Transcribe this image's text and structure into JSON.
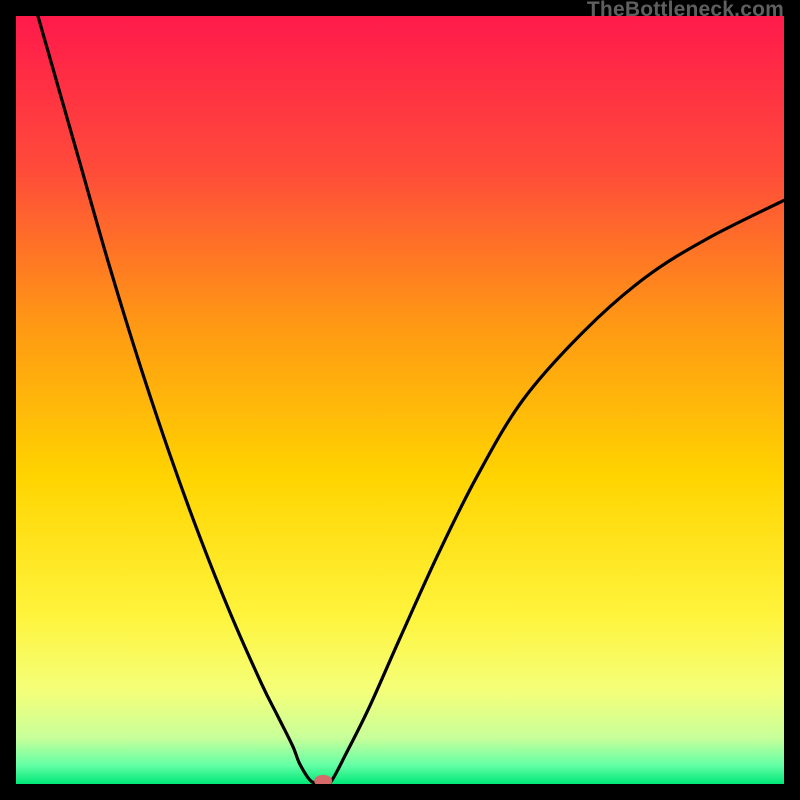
{
  "watermark": "TheBottleneck.com",
  "chart_data": {
    "type": "line",
    "title": "",
    "xlabel": "",
    "ylabel": "",
    "xlim": [
      0,
      100
    ],
    "ylim": [
      0,
      100
    ],
    "background_gradient": {
      "stops": [
        {
          "pos": 0.0,
          "color": "#ff1a4b"
        },
        {
          "pos": 0.2,
          "color": "#ff4b3a"
        },
        {
          "pos": 0.4,
          "color": "#ff9814"
        },
        {
          "pos": 0.6,
          "color": "#ffd400"
        },
        {
          "pos": 0.78,
          "color": "#fff43c"
        },
        {
          "pos": 0.88,
          "color": "#f4ff7a"
        },
        {
          "pos": 0.94,
          "color": "#c8ff9a"
        },
        {
          "pos": 0.975,
          "color": "#66ffa6"
        },
        {
          "pos": 1.0,
          "color": "#00e878"
        }
      ]
    },
    "curve": {
      "x": [
        0,
        4,
        8,
        12,
        16,
        20,
        24,
        28,
        32,
        34,
        36,
        37,
        38.5,
        40,
        41,
        43,
        46,
        50,
        55,
        60,
        66,
        74,
        82,
        90,
        100
      ],
      "y": [
        110,
        96,
        82,
        68,
        55,
        43,
        32,
        22,
        13,
        9,
        5,
        2.5,
        0.3,
        0.3,
        0.3,
        4,
        10,
        19,
        30,
        40,
        50,
        59,
        66,
        71,
        76
      ]
    },
    "marker": {
      "x": 40,
      "y": 0.4,
      "color": "#d46a6a"
    }
  }
}
